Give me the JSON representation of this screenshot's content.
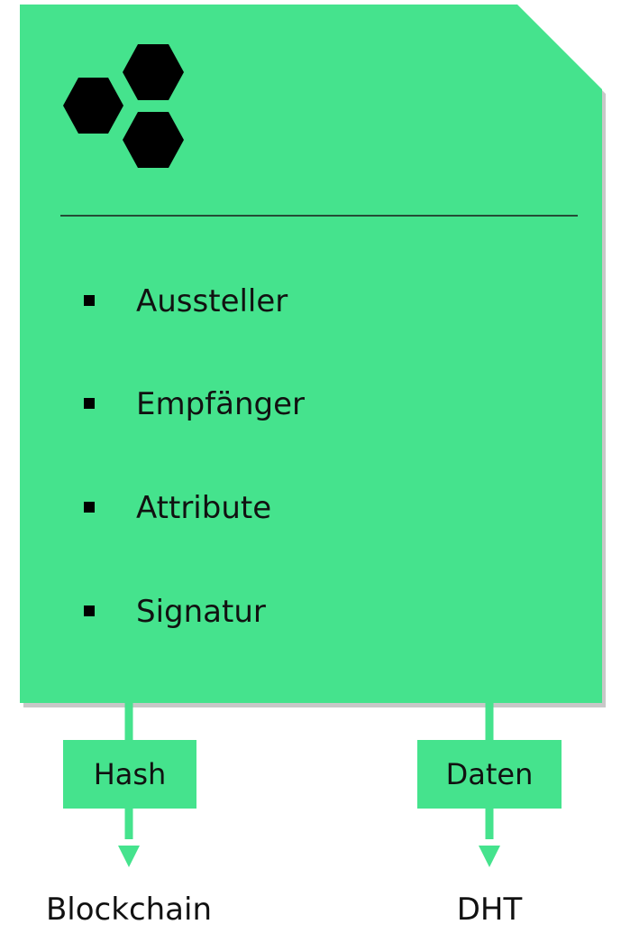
{
  "colors": {
    "card": "#45e38d",
    "card_shadow": "#9a9a9a",
    "connector": "#45e38d",
    "icon": "#000000",
    "text": "#111111"
  },
  "icon": "three-hexagons-logo-icon",
  "card": {
    "items": [
      "Aussteller",
      "Empfänger",
      "Attribute",
      "Signatur"
    ]
  },
  "outputs": [
    {
      "tag": "Hash",
      "target": "Blockchain"
    },
    {
      "tag": "Daten",
      "target": "DHT"
    }
  ]
}
